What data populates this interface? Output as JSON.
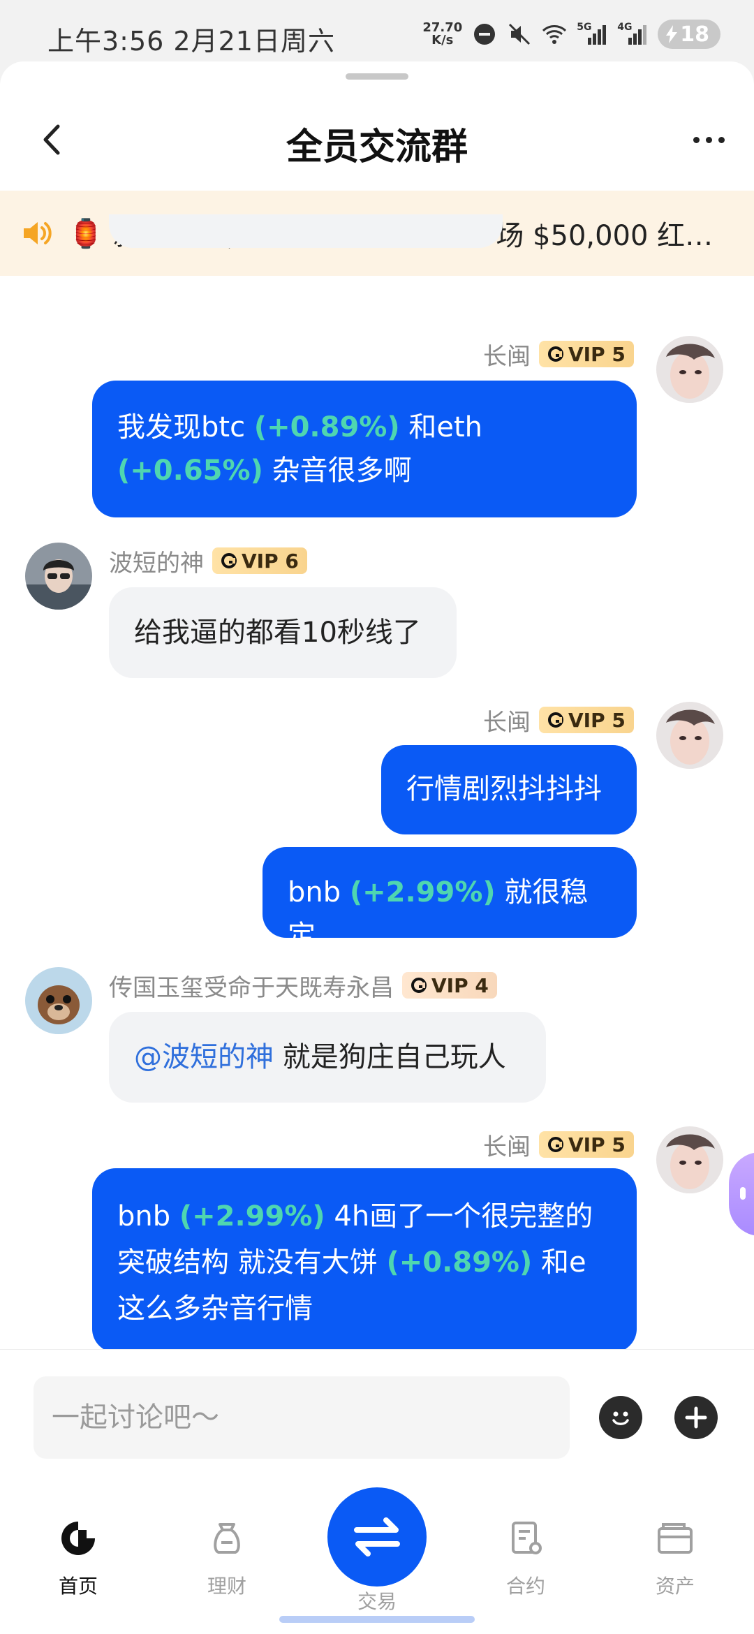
{
  "status": {
    "time": "上午3:56  2月21日周六",
    "netspeed_value": "27.70",
    "netspeed_unit": "K/s",
    "network_1": "5G",
    "network_2": "4G",
    "battery": "18"
  },
  "header": {
    "title": "全员交流群"
  },
  "notice": {
    "text": "新年快乐，马上发财！Gate 广场 $50,000 红…"
  },
  "messages": [
    {
      "side": "other",
      "partial": true,
      "text": "%%%%%%%%%%%%%%%"
    },
    {
      "side": "me",
      "sender": "长闽",
      "vip": "VIP 5",
      "parts": [
        [
          "t",
          "我发现btc "
        ],
        [
          "p",
          "(+0.89%)"
        ],
        [
          "t",
          " 和eth"
        ],
        [
          "br",
          ""
        ],
        [
          "p",
          "(+0.65%)"
        ],
        [
          "t",
          " 杂音很多啊"
        ]
      ]
    },
    {
      "side": "other",
      "sender": "波短的神",
      "vip": "VIP 6",
      "parts": [
        [
          "t",
          "给我逼的都看10秒线了"
        ]
      ]
    },
    {
      "side": "me",
      "sender": "长闽",
      "vip": "VIP 5",
      "parts": [
        [
          "t",
          "行情剧烈抖抖抖"
        ]
      ]
    },
    {
      "side": "me",
      "sender": "",
      "vip": "",
      "parts": [
        [
          "t",
          "bnb "
        ],
        [
          "p",
          "(+2.99%)"
        ],
        [
          "t",
          " 就很稳定"
        ]
      ]
    },
    {
      "side": "other",
      "sender": "传国玉玺受命于天既寿永昌",
      "vip": "VIP 4",
      "parts": [
        [
          "m",
          "@波短的神"
        ],
        [
          "t",
          " 就是狗庄自己玩人"
        ]
      ]
    },
    {
      "side": "me",
      "sender": "长闽",
      "vip": "VIP 5",
      "parts": [
        [
          "t",
          "bnb "
        ],
        [
          "p",
          "(+2.99%)"
        ],
        [
          "t",
          " 4h画了一个很完整的"
        ],
        [
          "br",
          ""
        ],
        [
          "t",
          "突破结构 就没有大饼 "
        ],
        [
          "p",
          "(+0.89%)"
        ],
        [
          "t",
          " 和e"
        ],
        [
          "br",
          ""
        ],
        [
          "t",
          "这么多杂音行情"
        ]
      ]
    }
  ],
  "composer": {
    "placeholder": "一起讨论吧～"
  },
  "tabs": [
    {
      "label": "首页",
      "icon": "gate-logo-icon",
      "active": true
    },
    {
      "label": "理财",
      "icon": "wealth-bag-icon",
      "active": false
    },
    {
      "label": "交易",
      "icon": "trade-swap-icon",
      "active": false
    },
    {
      "label": "合约",
      "icon": "contract-doc-icon",
      "active": false
    },
    {
      "label": "资产",
      "icon": "wallet-icon",
      "active": false
    }
  ],
  "colors": {
    "accent": "#0a5af5",
    "percent": "#4fd6b0",
    "mention": "#2f6fdc",
    "notice_bg": "#fdf3e4"
  }
}
